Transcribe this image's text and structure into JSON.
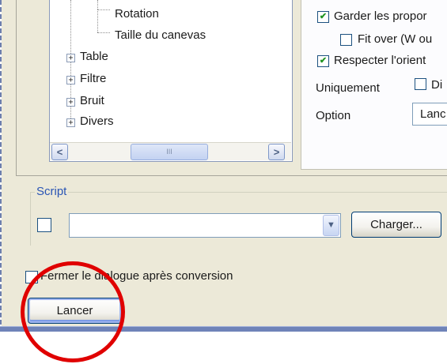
{
  "tree": {
    "items": [
      {
        "label": "Rotation",
        "expandable": false
      },
      {
        "label": "Taille du canevas",
        "expandable": false
      },
      {
        "label": "Table",
        "expandable": true
      },
      {
        "label": "Filtre",
        "expandable": true
      },
      {
        "label": "Bruit",
        "expandable": true
      },
      {
        "label": "Divers",
        "expandable": true
      }
    ],
    "expander_glyph": "+",
    "scroll_left": "<",
    "scroll_right": ">",
    "thumb_grip": "III"
  },
  "options": {
    "keep_proportions": {
      "label": "Garder les propor",
      "checked": true
    },
    "fit_over": {
      "label": "Fit over (W ou",
      "checked": false
    },
    "respect_orientation": {
      "label": "Respecter l'orient",
      "checked": true
    },
    "uniquement_label": "Uniquement",
    "uniquement_checkbox": {
      "label": "Di",
      "checked": false
    },
    "option_label": "Option",
    "option_value": "Lanc"
  },
  "script": {
    "group_label": "Script",
    "enabled": false,
    "combo_value": "",
    "load_button": "Charger..."
  },
  "close_after": {
    "label": "Fermer le dialogue après conversion",
    "checked": false
  },
  "run_button": "Lancer",
  "colors": {
    "dialog_bg": "#ece9d8",
    "highlight_circle": "#e00000",
    "checkmark": "#219421",
    "group_label": "#2a55b5"
  },
  "check_glyph": "✔"
}
